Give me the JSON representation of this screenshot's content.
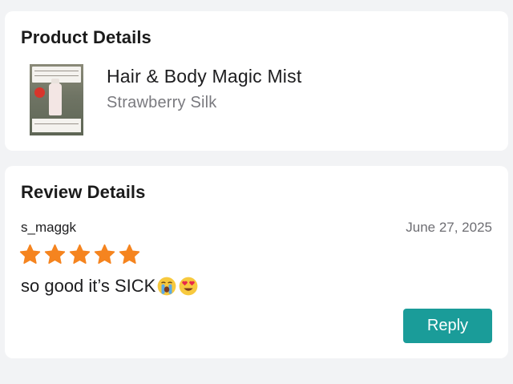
{
  "product_section": {
    "title": "Product Details",
    "product_name": "Hair & Body Magic Mist",
    "variant": "Strawberry Silk"
  },
  "review_section": {
    "title": "Review Details",
    "username": "s_maggk",
    "date": "June 27, 2025",
    "rating": 5,
    "rating_max": 5,
    "star_color": "#f5841f",
    "text": "so good it’s SICK",
    "emojis": [
      "loudly-crying-face",
      "heart-eyes-face"
    ],
    "reply_label": "Reply",
    "reply_color": "#1a9c99"
  }
}
